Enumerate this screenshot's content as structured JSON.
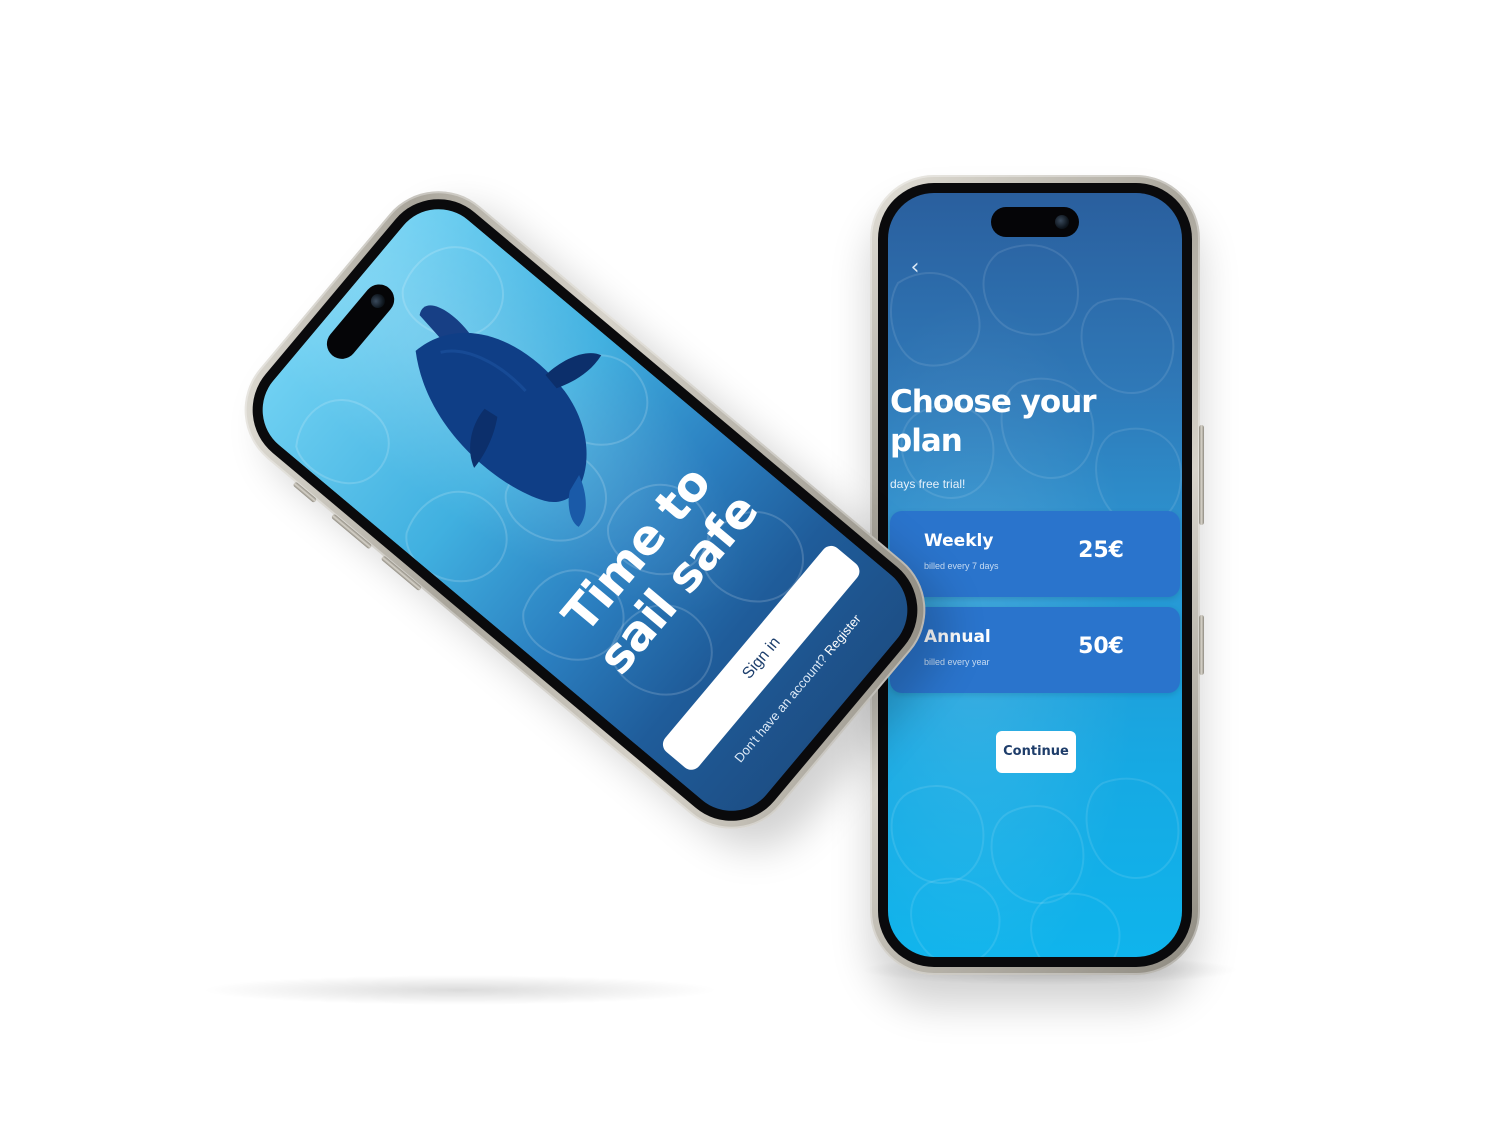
{
  "colors": {
    "background": "#ffffff",
    "brand_dark_blue": "#1d4f86",
    "water_light": "#6fd0f2",
    "plan_card": "#2a74cc",
    "button_text": "#1e3d6a"
  },
  "signin_screen": {
    "headline": "Time to sail safe",
    "sign_in_label": "Sign in",
    "register_prompt": "Don't have an account?",
    "register_link": "Register",
    "illustration": "dolphin-icon"
  },
  "plan_screen": {
    "back_icon": "chevron-left-icon",
    "back_glyph": "‹",
    "title": "Choose your plan",
    "subtitle": "days free trial!",
    "plans": [
      {
        "name": "Weekly",
        "billing": "billed every 7 days",
        "price": "25€"
      },
      {
        "name": "Annual",
        "billing": "billed every year",
        "price": "50€"
      }
    ],
    "continue_label": "Continue"
  }
}
